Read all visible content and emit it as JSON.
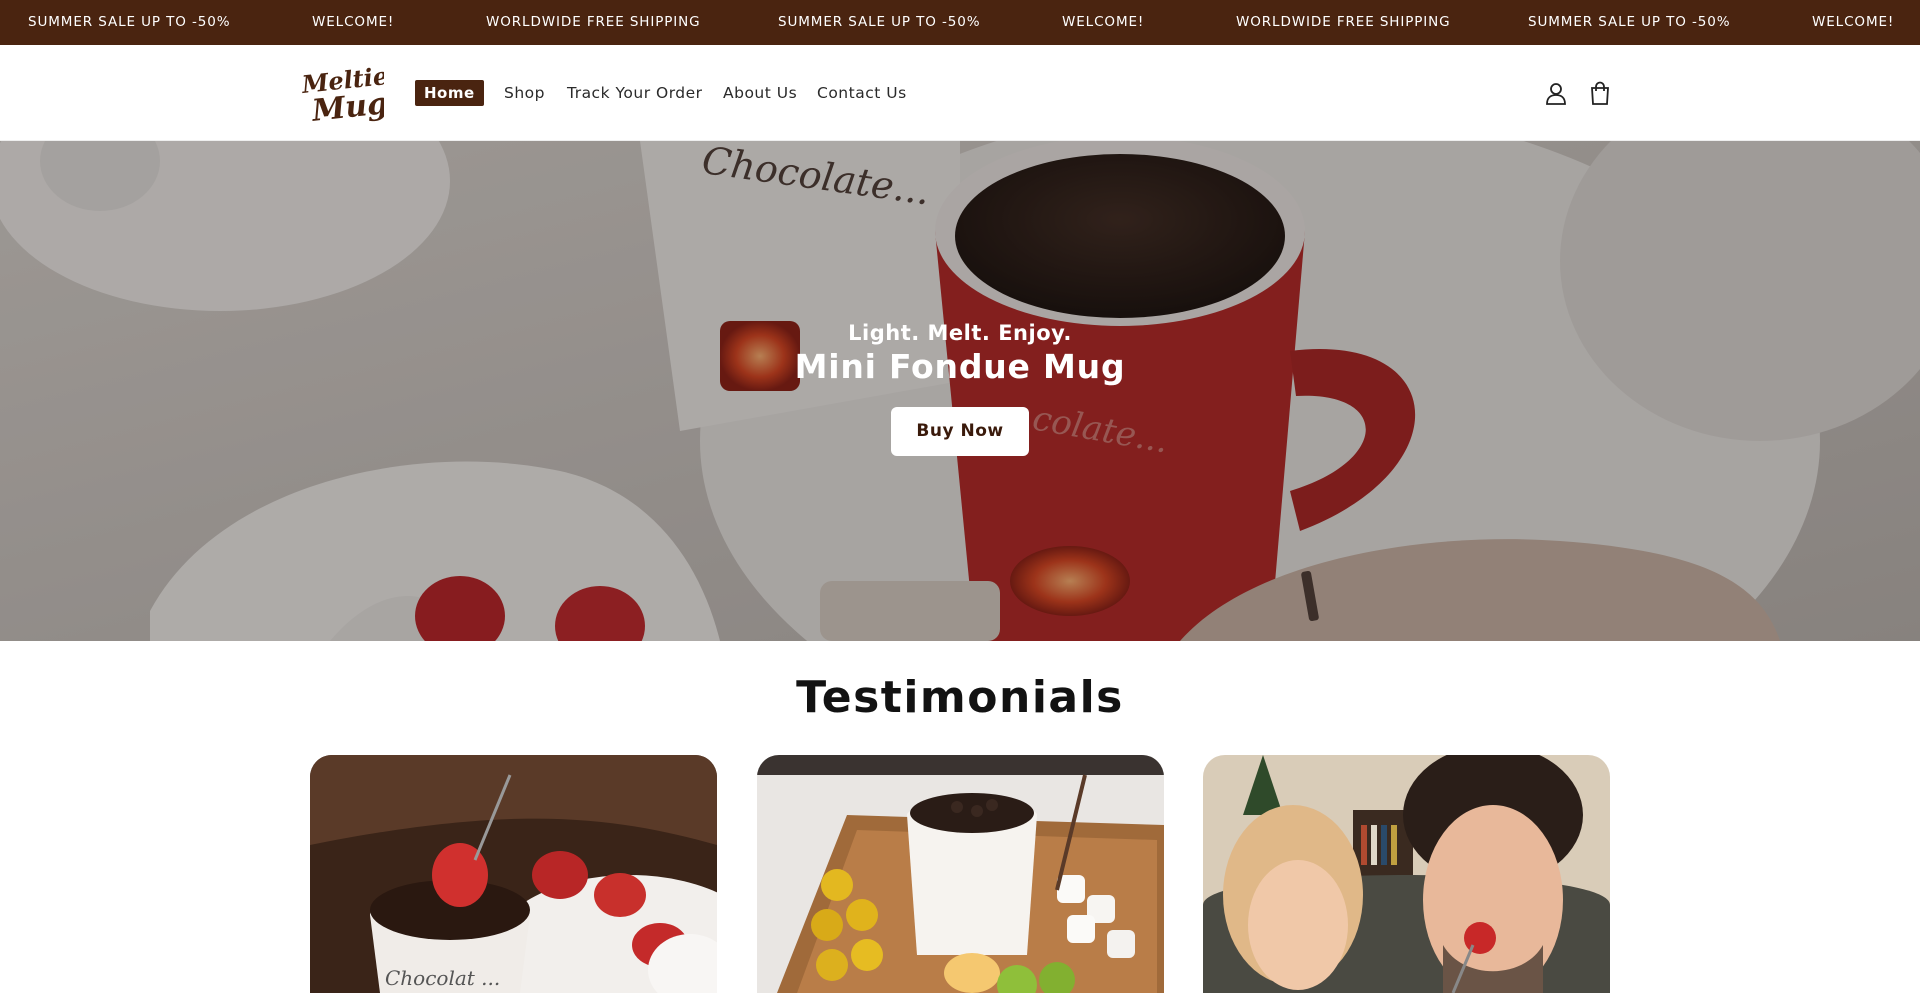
{
  "announcement": {
    "messages": [
      "SUMMER SALE UP TO -50%",
      "WELCOME!",
      "WORLDWIDE FREE SHIPPING",
      "SUMMER SALE UP TO -50%",
      "WELCOME!",
      "WORLDWIDE FREE SHIPPING",
      "SUMMER SALE UP TO -50%",
      "WELCOME!"
    ]
  },
  "header": {
    "logo": {
      "line1": "Meltie",
      "line2": "Mug"
    },
    "nav": [
      "Home",
      "Shop",
      "Track Your Order",
      "About Us",
      "Contact Us"
    ],
    "icons": [
      "account-icon",
      "cart-icon"
    ]
  },
  "hero": {
    "subtitle": "Light. Melt. Enjoy.",
    "title": "Mini Fondue Mug",
    "button": "Buy Now",
    "mug_text": "Chocolate..."
  },
  "testimonials": {
    "title": "Testimonials"
  },
  "colors": {
    "brand_brown": "#4a2410",
    "mug_red": "#b32322",
    "white": "#ffffff"
  }
}
